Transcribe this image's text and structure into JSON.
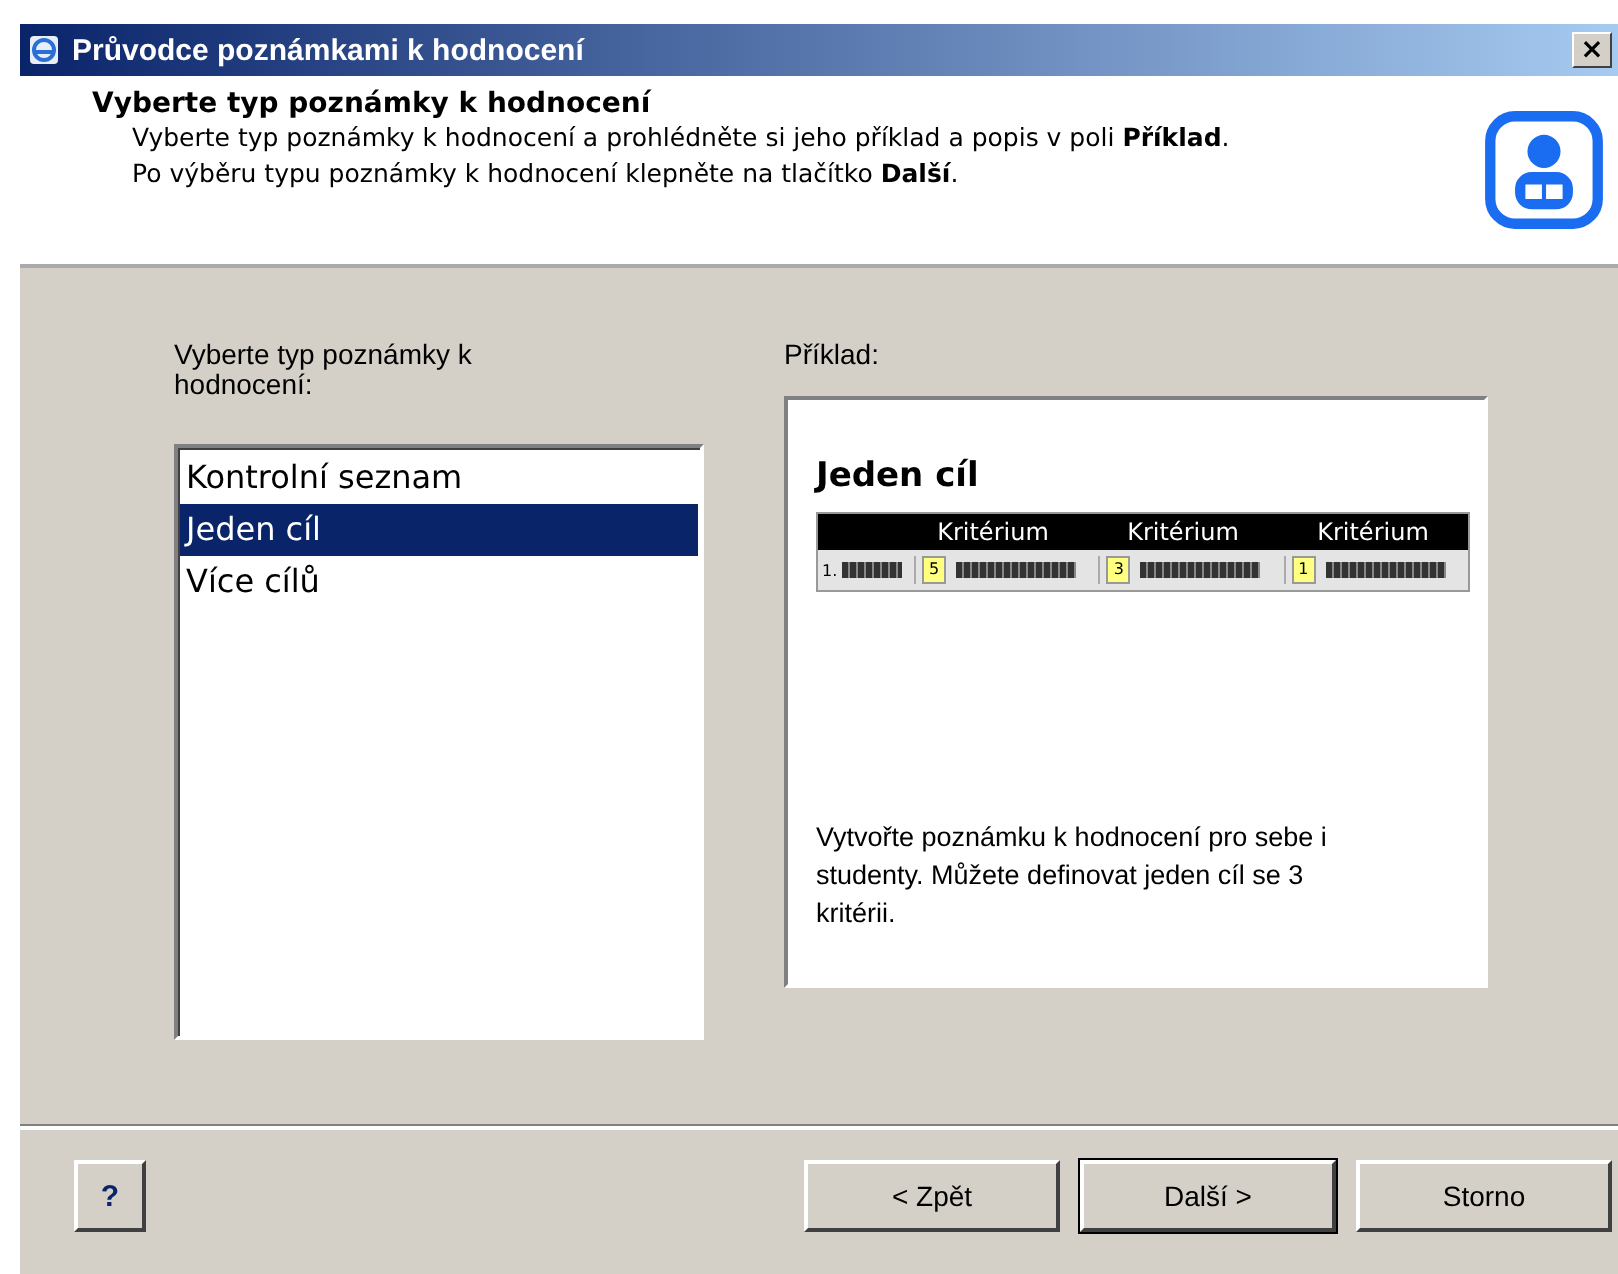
{
  "window": {
    "title": "Průvodce poznámkami k hodnocení",
    "close": "×"
  },
  "header": {
    "title": "Vyberte typ poznámky k hodnocení",
    "description": "Vyberte typ poznámky k hodnocení a prohlédněte si jeho příklad a popis v poli **Příklad**. Po výběru typu poznámky k hodnocení klepněte na tlačítko **Další**."
  },
  "list": {
    "label": "Vyberte typ poznámky k hodnocení:",
    "items": [
      {
        "label": "Kontrolní seznam",
        "selected": false
      },
      {
        "label": "Jeden cíl",
        "selected": true
      },
      {
        "label": "Více cílů",
        "selected": false
      }
    ]
  },
  "example": {
    "label": "Příklad:",
    "title": "Jeden cíl",
    "columns": [
      "Kritérium",
      "Kritérium",
      "Kritérium"
    ],
    "row_number": "1.",
    "scores": [
      "5",
      "3",
      "1"
    ],
    "description": "Vytvořte poznámku k hodnocení pro sebe i studenty. Můžete definovat jeden cíl se 3 kritérii."
  },
  "help": "?",
  "buttons": [
    {
      "label": "< Zpět",
      "default": false
    },
    {
      "label": "Další >",
      "default": true
    },
    {
      "label": "Storno",
      "default": false
    }
  ]
}
